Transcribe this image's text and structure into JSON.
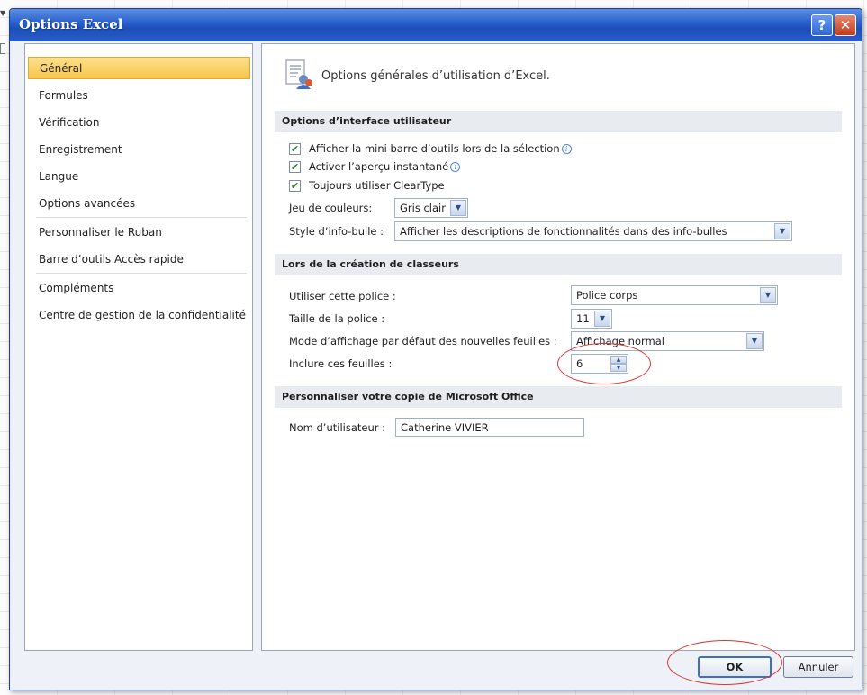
{
  "window": {
    "title": "Options Excel",
    "help_label": "?",
    "close_label": "✕"
  },
  "nav": {
    "items": [
      {
        "label": "Général"
      },
      {
        "label": "Formules"
      },
      {
        "label": "Vérification"
      },
      {
        "label": "Enregistrement"
      },
      {
        "label": "Langue"
      },
      {
        "label": "Options avancées"
      },
      {
        "label": "Personnaliser le Ruban"
      },
      {
        "label": "Barre d’outils Accès rapide"
      },
      {
        "label": "Compléments"
      },
      {
        "label": "Centre de gestion de la confidentialité"
      }
    ]
  },
  "panel": {
    "header": "Options générales d’utilisation d’Excel.",
    "ui_section": {
      "title": "Options d’interface utilisateur",
      "cb1_label": "Afficher la mini barre d’outils lors de la sélection",
      "cb2_label": "Activer l’aperçu instantané",
      "cb3_label": "Toujours utiliser ClearType",
      "check_glyph": "✔",
      "info_glyph": "i",
      "color_scheme_label": "Jeu de couleurs:",
      "color_scheme_value": "Gris clair",
      "tooltip_style_label": "Style d’info-bulle :",
      "tooltip_style_value": "Afficher les descriptions de fonctionnalités dans des info-bulles"
    },
    "workbook_section": {
      "title": "Lors de la création de classeurs",
      "font_label": "Utiliser cette police :",
      "font_value": "Police corps",
      "size_label": "Taille de la police :",
      "size_value": "11",
      "view_label": "Mode d’affichage par défaut des nouvelles feuilles :",
      "view_value": "Affichage normal",
      "sheets_label": "Inclure ces feuilles :",
      "sheets_value": "6"
    },
    "personalize_section": {
      "title": "Personnaliser votre copie de Microsoft Office",
      "username_label": "Nom d’utilisateur :",
      "username_value": "Catherine VIVIER"
    }
  },
  "footer": {
    "ok_label": "OK",
    "cancel_label": "Annuler"
  },
  "glyphs": {
    "dropdown": "▼",
    "spin_up": "▲",
    "spin_down": "▼",
    "bg_arrow": "▼"
  },
  "colors": {
    "title_bar": "#2b62cf",
    "selected_nav": "#f7c64b",
    "annotation": "#d8352f"
  }
}
